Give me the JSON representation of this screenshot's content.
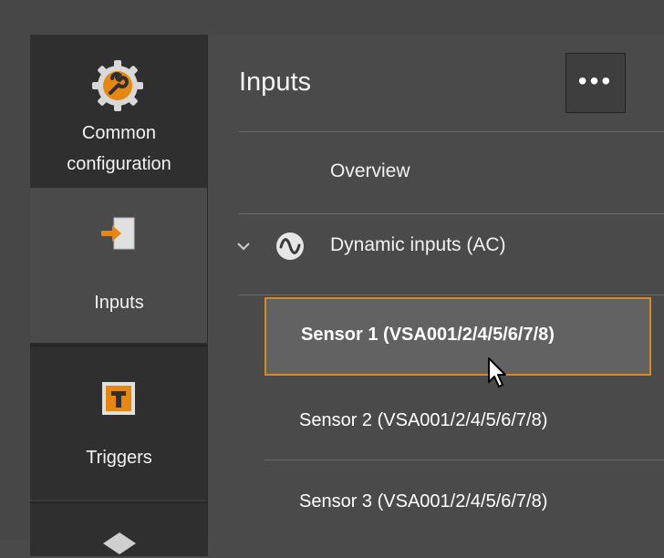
{
  "sidebar": {
    "items": [
      {
        "label_line1": "Common",
        "label_line2": "configuration",
        "icon": "wrench-gear-icon"
      },
      {
        "label": "Inputs",
        "icon": "input-arrow-icon"
      },
      {
        "label": "Triggers",
        "icon": "trigger-t-icon"
      },
      {
        "icon": "layers-icon"
      }
    ]
  },
  "panel": {
    "title": "Inputs",
    "more_label": "•••",
    "overview_label": "Overview",
    "group": {
      "label": "Dynamic inputs (AC)",
      "icon": "ac-sine-icon",
      "expanded_icon": "chevron-down-icon"
    },
    "sensors": [
      {
        "label": "Sensor 1 (VSA001/2/4/5/6/7/8)",
        "selected": true
      },
      {
        "label": "Sensor 2 (VSA001/2/4/5/6/7/8)",
        "selected": false
      },
      {
        "label": "Sensor 3 (VSA001/2/4/5/6/7/8)",
        "selected": false
      }
    ]
  },
  "colors": {
    "accent": "#d88a20",
    "selected_bg": "#626262",
    "sidebar_dark": "#2f2f2f"
  }
}
